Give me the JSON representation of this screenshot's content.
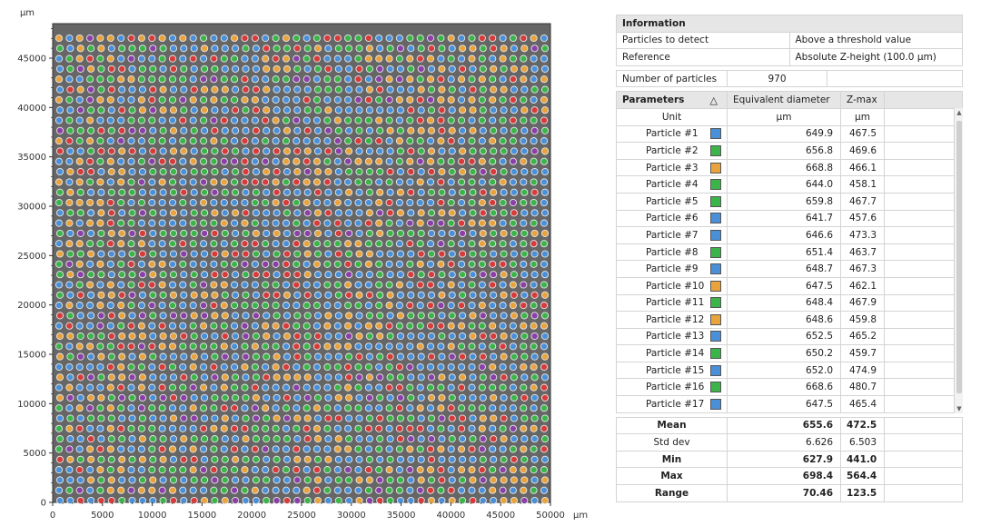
{
  "plot": {
    "y_unit": "µm",
    "x_unit": "µm",
    "x_ticks": [
      "0",
      "5000",
      "10000",
      "15000",
      "20000",
      "25000",
      "30000",
      "35000",
      "40000",
      "45000",
      "50000"
    ],
    "y_ticks": [
      "0",
      "5000",
      "10000",
      "15000",
      "20000",
      "25000",
      "30000",
      "35000",
      "40000",
      "45000"
    ],
    "x_range": [
      0,
      50000
    ],
    "y_range": [
      0,
      48500
    ],
    "grid_rows": 46,
    "grid_cols": 48,
    "background_color": "#666666",
    "particle_colors": [
      "#4a90d9",
      "#3bb54a",
      "#e8a33d",
      "#d83b3b",
      "#8b3fa8"
    ]
  },
  "information": {
    "header": "Information",
    "rows": [
      {
        "label": "Particles to detect",
        "value": "Above a threshold value"
      },
      {
        "label": "Reference",
        "value": "Absolute Z-height (100.0 µm)"
      }
    ]
  },
  "number_of_particles": {
    "label": "Number of particles",
    "value": "970"
  },
  "parameters": {
    "header": "Parameters",
    "sort_icon": "△",
    "columns": [
      "Equivalent diameter",
      "Z-max"
    ],
    "unit_label": "Unit",
    "units": [
      "µm",
      "µm"
    ],
    "rows": [
      {
        "name": "Particle #1",
        "color": "#4a90d9",
        "diameter": "649.9",
        "zmax": "467.5"
      },
      {
        "name": "Particle #2",
        "color": "#3bb54a",
        "diameter": "656.8",
        "zmax": "469.6"
      },
      {
        "name": "Particle #3",
        "color": "#e8a33d",
        "diameter": "668.8",
        "zmax": "466.1"
      },
      {
        "name": "Particle #4",
        "color": "#3bb54a",
        "diameter": "644.0",
        "zmax": "458.1"
      },
      {
        "name": "Particle #5",
        "color": "#3bb54a",
        "diameter": "659.8",
        "zmax": "467.7"
      },
      {
        "name": "Particle #6",
        "color": "#4a90d9",
        "diameter": "641.7",
        "zmax": "457.6"
      },
      {
        "name": "Particle #7",
        "color": "#4a90d9",
        "diameter": "646.6",
        "zmax": "473.3"
      },
      {
        "name": "Particle #8",
        "color": "#3bb54a",
        "diameter": "651.4",
        "zmax": "463.7"
      },
      {
        "name": "Particle #9",
        "color": "#4a90d9",
        "diameter": "648.7",
        "zmax": "467.3"
      },
      {
        "name": "Particle #10",
        "color": "#e8a33d",
        "diameter": "647.5",
        "zmax": "462.1"
      },
      {
        "name": "Particle #11",
        "color": "#3bb54a",
        "diameter": "648.4",
        "zmax": "467.9"
      },
      {
        "name": "Particle #12",
        "color": "#e8a33d",
        "diameter": "648.6",
        "zmax": "459.8"
      },
      {
        "name": "Particle #13",
        "color": "#4a90d9",
        "diameter": "652.5",
        "zmax": "465.2"
      },
      {
        "name": "Particle #14",
        "color": "#3bb54a",
        "diameter": "650.2",
        "zmax": "459.7"
      },
      {
        "name": "Particle #15",
        "color": "#4a90d9",
        "diameter": "652.0",
        "zmax": "474.9"
      },
      {
        "name": "Particle #16",
        "color": "#3bb54a",
        "diameter": "668.6",
        "zmax": "480.7"
      },
      {
        "name": "Particle #17",
        "color": "#4a90d9",
        "diameter": "647.5",
        "zmax": "465.4"
      }
    ]
  },
  "statistics": [
    {
      "label": "Mean",
      "diameter": "655.6",
      "zmax": "472.5",
      "bold": true
    },
    {
      "label": "Std dev",
      "diameter": "6.626",
      "zmax": "6.503",
      "bold": false
    },
    {
      "label": "Min",
      "diameter": "627.9",
      "zmax": "441.0",
      "bold": true
    },
    {
      "label": "Max",
      "diameter": "698.4",
      "zmax": "564.4",
      "bold": true
    },
    {
      "label": "Range",
      "diameter": "70.46",
      "zmax": "123.5",
      "bold": true
    }
  ]
}
